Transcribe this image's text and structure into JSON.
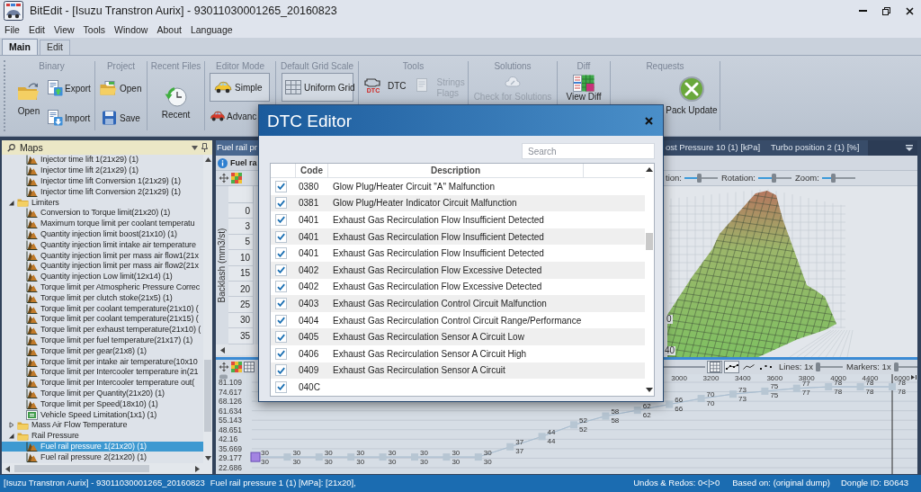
{
  "window": {
    "title": "BitEdit - [Isuzu Transtron Aurix] - 93011030001265_20160823"
  },
  "menu": [
    "File",
    "Edit",
    "View",
    "Tools",
    "Window",
    "About",
    "Language"
  ],
  "ribbon_tabs": [
    {
      "label": "Main",
      "selected": true
    },
    {
      "label": "Edit",
      "selected": false
    }
  ],
  "ribbon_groups": [
    {
      "title": "Binary",
      "buttons": [
        {
          "label": "Open"
        },
        {
          "label": "Export"
        },
        {
          "label": "Import"
        }
      ]
    },
    {
      "title": "Project",
      "buttons": [
        {
          "label": "Open"
        },
        {
          "label": "Save"
        }
      ]
    },
    {
      "title": "Recent Files",
      "buttons": [
        {
          "label": "Recent"
        }
      ]
    },
    {
      "title": "Editor Mode",
      "buttons": [
        {
          "label": "Simple",
          "selected": true
        },
        {
          "label": "Advanc",
          "selected": false
        }
      ]
    },
    {
      "title": "Default Grid Scale",
      "buttons": [
        {
          "label": "Uniform Grid",
          "selected": true
        }
      ]
    },
    {
      "title": "Tools",
      "buttons": [
        {
          "label": "DTC",
          "icon_caption": "DTC",
          "disabled": false
        },
        {
          "label": "Strings Flags",
          "disabled": true
        }
      ]
    },
    {
      "title": "Solutions",
      "buttons": [
        {
          "label": "Check for Solutions",
          "disabled": true
        }
      ]
    },
    {
      "title": "Diff",
      "buttons": [
        {
          "label": "View Diff"
        }
      ]
    },
    {
      "title": "Requests",
      "buttons": [
        {
          "label": "Pack Update"
        }
      ]
    }
  ],
  "maps_panel": {
    "title": "Maps",
    "tree": [
      {
        "children": [
          {
            "label": "Injector time lift 1(21x29) (1)",
            "kind": "map",
            "selected": false
          },
          {
            "label": "Injector time lift 2(21x29) (1)",
            "kind": "map",
            "selected": false
          },
          {
            "label": "Injector time lift Conversion 1(21x29) (1)",
            "kind": "map",
            "selected": false
          },
          {
            "label": "Injector time lift Conversion 2(21x29) (1)",
            "kind": "map",
            "selected": false
          }
        ]
      },
      {
        "label": "Limiters",
        "kind": "folder",
        "expanded": true,
        "selected": false,
        "children": [
          {
            "label": "Conversion to Torque limit(21x20) (1)",
            "kind": "map",
            "selected": false
          },
          {
            "label": "Maximum torque limit per coolant temperatu",
            "kind": "map",
            "selected": false
          },
          {
            "label": "Quantity injection limit boost(21x10) (1)",
            "kind": "map",
            "selected": false
          },
          {
            "label": "Quantity injection limit intake air temperature",
            "kind": "map",
            "selected": false
          },
          {
            "label": "Quantity injection limit per mass air flow1(21x",
            "kind": "map",
            "selected": false
          },
          {
            "label": "Quantity injection limit per mass air flow2(21x",
            "kind": "map",
            "selected": false
          },
          {
            "label": "Quantity injection Low limit(12x14) (1)",
            "kind": "map",
            "selected": false
          },
          {
            "label": "Torque limit per Atmospheric Pressure Correc",
            "kind": "map",
            "selected": false
          },
          {
            "label": "Torque limit per clutch stoke(21x5) (1)",
            "kind": "map",
            "selected": false
          },
          {
            "label": "Torque limit per coolant temperature(21x10) (",
            "kind": "map",
            "selected": false
          },
          {
            "label": "Torque limit per coolant temperature(21x15) (",
            "kind": "map",
            "selected": false
          },
          {
            "label": "Torque limit per exhaust temperature(21x10) (",
            "kind": "map",
            "selected": false
          },
          {
            "label": "Torque limit per fuel temperature(21x17) (1)",
            "kind": "map",
            "selected": false
          },
          {
            "label": "Torque limit per gear(21x8) (1)",
            "kind": "map",
            "selected": false
          },
          {
            "label": "Torque limit per intake air temperature(10x10",
            "kind": "map",
            "selected": false
          },
          {
            "label": "Torque limit per Intercooler temperature in(21",
            "kind": "map",
            "selected": false
          },
          {
            "label": "Torque limit per Intercooler temperature out(",
            "kind": "map",
            "selected": false
          },
          {
            "label": "Torque limit per Quantity(21x20) (1)",
            "kind": "map",
            "selected": false
          },
          {
            "label": "Torque limit per Speed(18x10) (1)",
            "kind": "map",
            "selected": false
          },
          {
            "label": "Vehicle Speed Limitation(1x1) (1)",
            "kind": "value",
            "selected": false
          }
        ]
      },
      {
        "label": "Mass Air Flow Temperature",
        "kind": "folder",
        "expanded": false,
        "selected": false
      },
      {
        "label": "Rail Pressure",
        "kind": "folder",
        "expanded": true,
        "selected": false,
        "children": [
          {
            "label": "Fuel rail pressure 1(21x20) (1)",
            "kind": "map",
            "selected": true
          },
          {
            "label": "Fuel rail pressure 2(21x20) (1)",
            "kind": "map",
            "selected": false
          }
        ]
      }
    ]
  },
  "document": {
    "tabs": [
      {
        "label": "Fuel rail pr",
        "selected": true
      },
      {
        "label": "ost Pressure 10 (1) [kPa]",
        "selected": false
      },
      {
        "label": "Turbo position 2 (1) [%]",
        "selected": false
      }
    ],
    "title": "Fuel ra",
    "grid": {
      "axis_label": "Backlash (mm3/st)",
      "row_headers": [
        "0",
        "3",
        "5",
        "10",
        "15",
        "20",
        "25",
        "30",
        "35"
      ]
    },
    "view_3d": {
      "sliders": [
        {
          "label": "tion:",
          "level": 0.45
        },
        {
          "label": "Rotation:",
          "level": 0.47
        },
        {
          "label": "Zoom:",
          "level": 0.33
        }
      ],
      "axis_labels": [
        "0",
        "40"
      ]
    },
    "chart_toolbar": {
      "view_buttons": [
        {
          "selected": true
        },
        {
          "selected": true
        },
        {
          "selected": false
        },
        {
          "selected": false
        }
      ],
      "sliders": [
        {
          "label": "Lines: 1x",
          "level": 0
        },
        {
          "label": "Markers: 1x",
          "level": 0
        }
      ]
    },
    "chart_data": {
      "type": "line",
      "categories": [
        null,
        null,
        null,
        null,
        null,
        null,
        null,
        null,
        null,
        null,
        null,
        null,
        null,
        "3000",
        "3200",
        "3400",
        "3600",
        "3800",
        "4000",
        "4400",
        "6000"
      ],
      "ylim": [
        18.38,
        86.64
      ],
      "yticks": [
        81.109,
        74.617,
        68.126,
        61.634,
        55.143,
        48.651,
        42.16,
        35.669,
        29.177,
        22.686
      ],
      "grid": true,
      "series": [
        {
          "color": "#b7c6d3",
          "marker": "square",
          "values": [
            30,
            30,
            30,
            30,
            30,
            30,
            30,
            30,
            37,
            44,
            52,
            58,
            62,
            66,
            70,
            73,
            75,
            77,
            78,
            78,
            78
          ]
        },
        {
          "color": "#a9bdd0",
          "values": [
            30,
            30,
            30,
            30,
            30,
            30,
            30,
            30,
            37,
            44,
            52,
            58,
            62,
            66,
            70,
            73,
            75,
            77,
            78,
            78,
            78
          ]
        }
      ],
      "data_labels": true
    },
    "chart_points": [
      {
        "selected": true
      },
      {
        "selected": false
      },
      {
        "selected": false
      },
      {
        "selected": false
      },
      {
        "selected": false
      },
      {
        "selected": false
      },
      {
        "selected": false
      },
      {
        "selected": false
      },
      {
        "selected": false
      },
      {
        "selected": false
      },
      {
        "selected": false
      },
      {
        "selected": false
      },
      {
        "selected": false
      },
      {
        "selected": false
      },
      {
        "selected": false
      },
      {
        "selected": false
      },
      {
        "selected": false
      },
      {
        "selected": false
      },
      {
        "selected": false
      },
      {
        "selected": false
      },
      {
        "selected": false
      }
    ]
  },
  "dialog": {
    "title": "DTC Editor",
    "search": {
      "placeholder": "Search"
    },
    "columns": [
      "Code",
      "Description"
    ],
    "rows": [
      {
        "checked": true,
        "code": "0380",
        "description": "Glow Plug/Heater Circuit \"A\" Malfunction"
      },
      {
        "checked": true,
        "code": "0381",
        "description": "Glow Plug/Heater Indicator Circuit Malfunction"
      },
      {
        "checked": true,
        "code": "0401",
        "description": "Exhaust Gas Recirculation Flow Insufficient Detected"
      },
      {
        "checked": true,
        "code": "0401",
        "description": "Exhaust Gas Recirculation Flow Insufficient Detected"
      },
      {
        "checked": true,
        "code": "0401",
        "description": "Exhaust Gas Recirculation Flow Insufficient Detected"
      },
      {
        "checked": true,
        "code": "0402",
        "description": "Exhaust Gas Recirculation Flow Excessive Detected"
      },
      {
        "checked": true,
        "code": "0402",
        "description": "Exhaust Gas Recirculation Flow Excessive Detected"
      },
      {
        "checked": true,
        "code": "0403",
        "description": "Exhaust Gas Recirculation Control Circuit Malfunction"
      },
      {
        "checked": true,
        "code": "0404",
        "description": "Exhaust Gas Recirculation Control Circuit Range/Performance"
      },
      {
        "checked": true,
        "code": "0405",
        "description": "Exhaust Gas Recirculation Sensor A Circuit Low"
      },
      {
        "checked": true,
        "code": "0406",
        "description": "Exhaust Gas Recirculation Sensor A Circuit High"
      },
      {
        "checked": true,
        "code": "0409",
        "description": "Exhaust Gas Recirculation Sensor A Circuit"
      },
      {
        "checked": true,
        "code": "040C"
      }
    ]
  },
  "status_bar": [
    "[Isuzu Transtron Aurix] - 93011030001265_20160823",
    "Fuel rail pressure 1 (1) [MPa]: [21x20],",
    "Undos & Redos: 0<|>0",
    "Based on: (original dump)",
    "Dongle ID: B0643"
  ]
}
